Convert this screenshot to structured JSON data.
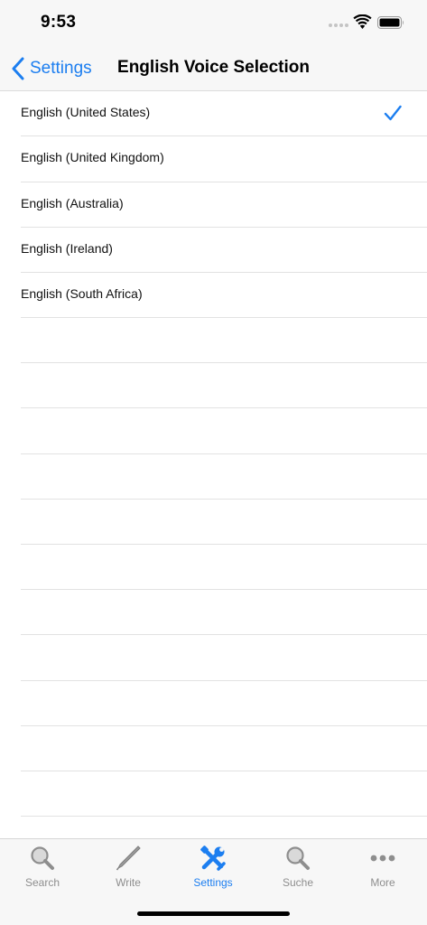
{
  "status": {
    "time": "9:53"
  },
  "nav": {
    "back_label": "Settings",
    "title": "English Voice Selection"
  },
  "voices": [
    {
      "label": "English (United States)",
      "selected": true
    },
    {
      "label": "English (United Kingdom)",
      "selected": false
    },
    {
      "label": "English (Australia)",
      "selected": false
    },
    {
      "label": "English (Ireland)",
      "selected": false
    },
    {
      "label": "English (South Africa)",
      "selected": false
    }
  ],
  "tabs": [
    {
      "label": "Search",
      "icon": "magnifier-icon",
      "active": false
    },
    {
      "label": "Write",
      "icon": "pencil-icon",
      "active": false
    },
    {
      "label": "Settings",
      "icon": "tools-icon",
      "active": true
    },
    {
      "label": "Suche",
      "icon": "magnifier-icon",
      "active": false
    },
    {
      "label": "More",
      "icon": "more-dots-icon",
      "active": false
    }
  ],
  "colors": {
    "accent": "#1c7ef0",
    "inactive": "#8e8e8e",
    "bar_background": "#f7f7f7"
  }
}
